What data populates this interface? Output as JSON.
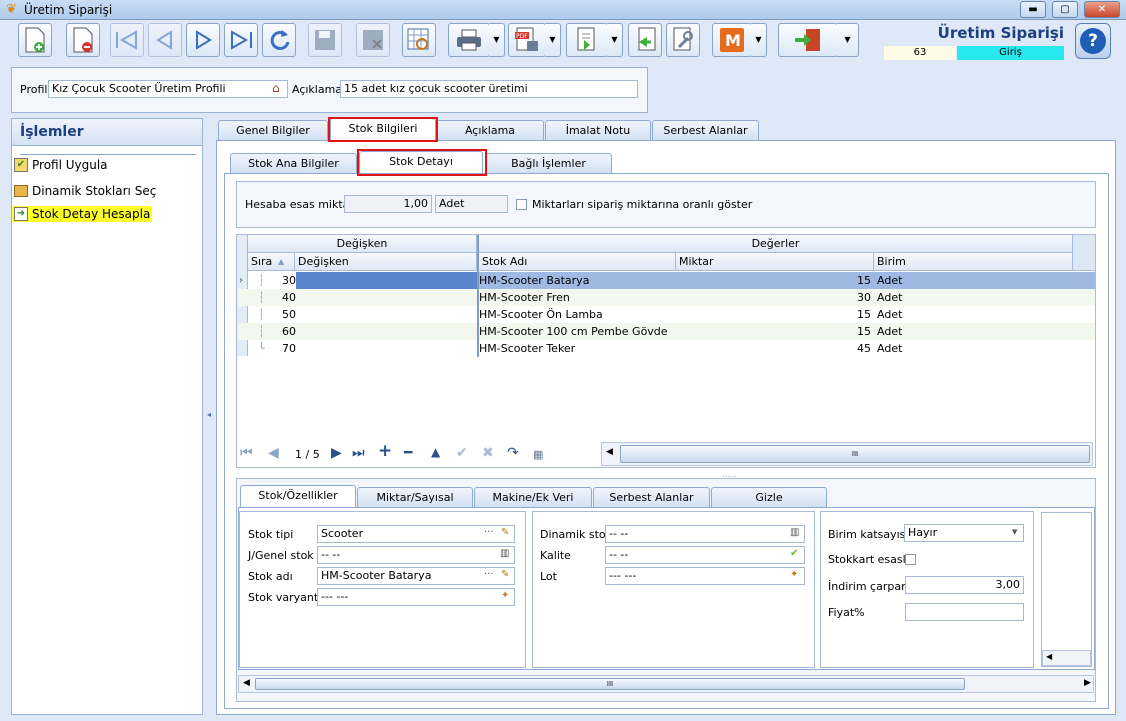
{
  "window": {
    "title": "Üretim Siparişi",
    "minimize": "▬",
    "maximize": "▢",
    "close": "✕"
  },
  "header": {
    "title": "Üretim Siparişi",
    "number": "63",
    "status": "Giriş",
    "help": "?"
  },
  "profile": {
    "label": "Profil",
    "value": "Kız Çocuk Scooter Üretim Profili",
    "desc_label": "Açıklama",
    "desc_value": "15 adet kız çocuk scooter üretimi"
  },
  "sidebar": {
    "title": "İşlemler",
    "items": [
      {
        "label": "Profil Uygula"
      },
      {
        "label": "Dinamik Stokları Seç"
      },
      {
        "label": "Stok Detay Hesapla"
      }
    ]
  },
  "main_tabs": [
    "Genel Bilgiler",
    "Stok Bilgileri",
    "Açıklama",
    "İmalat Notu",
    "Serbest Alanlar"
  ],
  "sub_tabs": [
    "Stok Ana Bilgiler",
    "Stok Detayı",
    "Bağlı İşlemler"
  ],
  "hesaba": {
    "label": "Hesaba esas miktar",
    "value": "1,00",
    "unit": "Adet",
    "checkbox_label": "Miktarları sipariş miktarına oranlı göster"
  },
  "grid": {
    "group_left": "Değişken",
    "group_right": "Değerler",
    "columns": [
      "Sıra",
      "Değişken",
      "Stok Adı",
      "Miktar",
      "Birim"
    ],
    "rows": [
      {
        "sira": "30",
        "stok": "HM-Scooter Batarya",
        "miktar": "15",
        "birim": "Adet"
      },
      {
        "sira": "40",
        "stok": "HM-Scooter Fren",
        "miktar": "30",
        "birim": "Adet"
      },
      {
        "sira": "50",
        "stok": "HM-Scooter Ön Lamba",
        "miktar": "15",
        "birim": "Adet"
      },
      {
        "sira": "60",
        "stok": "HM-Scooter 100 cm Pembe Gövde",
        "miktar": "15",
        "birim": "Adet"
      },
      {
        "sira": "70",
        "stok": "HM-Scooter Teker",
        "miktar": "45",
        "birim": "Adet"
      }
    ],
    "pager": "1 / 5",
    "splitter": "....."
  },
  "bottom_tabs": [
    "Stok/Özellikler",
    "Miktar/Sayısal",
    "Makine/Ek Veri",
    "Serbest Alanlar",
    "Gizle"
  ],
  "props": {
    "stok_tipi_label": "Stok tipi",
    "stok_tipi": "Scooter",
    "genel_stok_label": "J/Genel stok",
    "genel_stok": "-- --",
    "stok_adi_label": "Stok adı",
    "stok_adi": "HM-Scooter Batarya",
    "stok_varyanti_label": "Stok varyantı",
    "stok_varyanti": "--- ---",
    "dinamik_stok_label": "Dinamik stok",
    "dinamik_stok": "-- --",
    "kalite_label": "Kalite",
    "kalite": "-- --",
    "lot_label": "Lot",
    "lot": "--- ---",
    "birim_katsayisi_label": "Birim katsayısı",
    "birim_katsayisi": "Hayır",
    "stokkart_label": "Stokkart esaslı",
    "indirim_label": "İndirim çarpanı",
    "indirim": "3,00",
    "fiyat_label": "Fiyat%",
    "fiyat": ""
  }
}
